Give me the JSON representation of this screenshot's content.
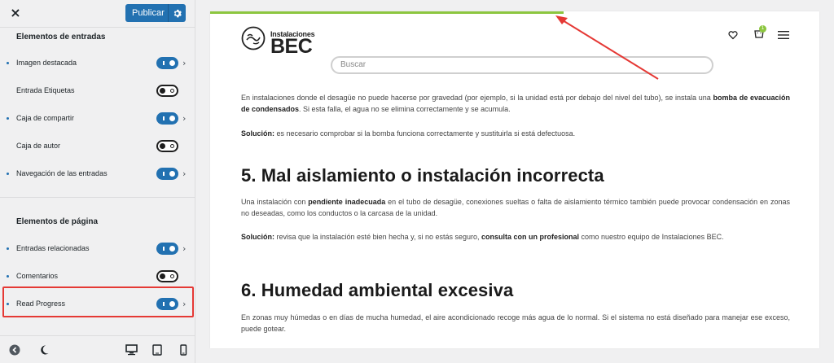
{
  "topbar": {
    "close_label": "×",
    "publish_label": "Publicar"
  },
  "sidebar": {
    "section1_title": "Elementos de entradas",
    "section1_items": [
      {
        "label": "Imagen destacada",
        "dot": true,
        "on": true,
        "chevron": true
      },
      {
        "label": "Entrada Etiquetas",
        "dot": false,
        "on": false,
        "chevron": false
      },
      {
        "label": "Caja de compartir",
        "dot": true,
        "on": true,
        "chevron": true
      },
      {
        "label": "Caja de autor",
        "dot": false,
        "on": false,
        "chevron": false
      },
      {
        "label": "Navegación de las entradas",
        "dot": true,
        "on": true,
        "chevron": true
      }
    ],
    "section2_title": "Elementos de página",
    "section2_items": [
      {
        "label": "Entradas relacionadas",
        "dot": true,
        "on": true,
        "chevron": true
      },
      {
        "label": "Comentarios",
        "dot": true,
        "on": false,
        "chevron": false
      },
      {
        "label": "Read Progress",
        "dot": true,
        "on": true,
        "chevron": true
      }
    ],
    "chevron_glyph": "›"
  },
  "preview": {
    "read_progress_fraction": 0.58,
    "logo_line1": "Instalaciones",
    "logo_line2": "BEC",
    "cart_count": "1",
    "search_placeholder": "Buscar",
    "para1_a": "En instalaciones donde el desagüe no puede hacerse por gravedad (por ejemplo, si la unidad está por debajo del nivel del tubo), se instala una ",
    "para1_b": "bomba de evacuación de condensados",
    "para1_c": ". Si esta falla, el agua no se elimina correctamente y se acumula.",
    "para2_a": "Solución:",
    "para2_b": " es necesario comprobar si la bomba funciona correctamente y sustituirla si está defectuosa.",
    "heading5": "5. Mal aislamiento o instalación incorrecta",
    "para3_a": "Una instalación con ",
    "para3_b": "pendiente inadecuada",
    "para3_c": " en el tubo de desagüe, conexiones sueltas o falta de aislamiento térmico también puede provocar condensación en zonas no deseadas, como los conductos o la carcasa de la unidad.",
    "para4_a": "Solución:",
    "para4_b": " revisa que la instalación esté bien hecha y, si no estás seguro, ",
    "para4_c": "consulta con un profesional",
    "para4_d": " como nuestro equipo de Instalaciones BEC.",
    "heading6": "6. Humedad ambiental excesiva",
    "para5": "En zonas muy húmedas o en días de mucha humedad, el aire acondicionado recoge más agua de lo normal. Si el sistema no está diseñado para manejar ese exceso, puede gotear."
  },
  "colors": {
    "accent": "#2271b1",
    "progress": "#8cc63f",
    "highlight": "#e53935"
  }
}
